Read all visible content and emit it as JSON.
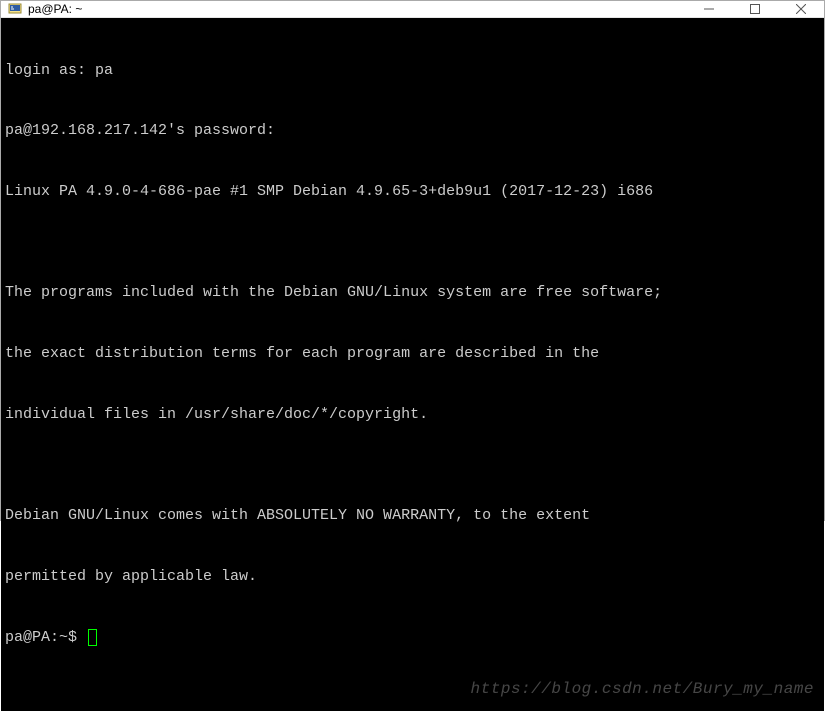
{
  "window": {
    "title": "pa@PA: ~"
  },
  "terminal": {
    "lines": [
      "login as: pa",
      "pa@192.168.217.142's password:",
      "Linux PA 4.9.0-4-686-pae #1 SMP Debian 4.9.65-3+deb9u1 (2017-12-23) i686",
      "",
      "The programs included with the Debian GNU/Linux system are free software;",
      "the exact distribution terms for each program are described in the",
      "individual files in /usr/share/doc/*/copyright.",
      "",
      "Debian GNU/Linux comes with ABSOLUTELY NO WARRANTY, to the extent",
      "permitted by applicable law."
    ],
    "prompt": "pa@PA:~$ "
  },
  "watermark": "https://blog.csdn.net/Bury_my_name"
}
